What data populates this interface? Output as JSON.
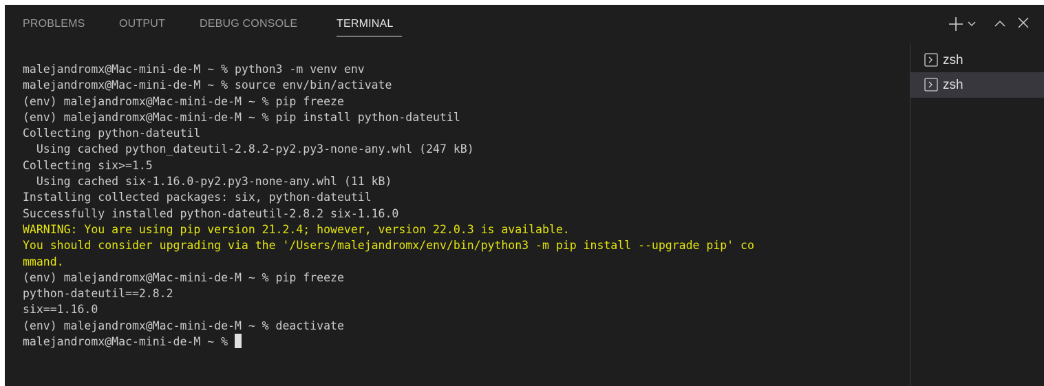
{
  "tabs": [
    {
      "label": "PROBLEMS",
      "active": false
    },
    {
      "label": "OUTPUT",
      "active": false
    },
    {
      "label": "DEBUG CONSOLE",
      "active": false
    },
    {
      "label": "TERMINAL",
      "active": true
    }
  ],
  "toolbar": {
    "icons": [
      "plus-icon",
      "chevron-down-icon",
      "chevron-up-icon",
      "close-icon"
    ]
  },
  "terminal": {
    "lines": [
      {
        "text": "malejandromx@Mac-mini-de-M ~ % python3 -m venv env",
        "kind": "normal"
      },
      {
        "text": "malejandromx@Mac-mini-de-M ~ % source env/bin/activate",
        "kind": "normal"
      },
      {
        "text": "(env) malejandromx@Mac-mini-de-M ~ % pip freeze",
        "kind": "normal"
      },
      {
        "text": "(env) malejandromx@Mac-mini-de-M ~ % pip install python-dateutil",
        "kind": "normal"
      },
      {
        "text": "Collecting python-dateutil",
        "kind": "normal"
      },
      {
        "text": "  Using cached python_dateutil-2.8.2-py2.py3-none-any.whl (247 kB)",
        "kind": "normal"
      },
      {
        "text": "Collecting six>=1.5",
        "kind": "normal"
      },
      {
        "text": "  Using cached six-1.16.0-py2.py3-none-any.whl (11 kB)",
        "kind": "normal"
      },
      {
        "text": "Installing collected packages: six, python-dateutil",
        "kind": "normal"
      },
      {
        "text": "Successfully installed python-dateutil-2.8.2 six-1.16.0",
        "kind": "normal"
      },
      {
        "text": "WARNING: You are using pip version 21.2.4; however, version 22.0.3 is available.",
        "kind": "warn"
      },
      {
        "text": "You should consider upgrading via the '/Users/malejandromx/env/bin/python3 -m pip install --upgrade pip' co",
        "kind": "warn"
      },
      {
        "text": "mmand.",
        "kind": "warn"
      },
      {
        "text": "(env) malejandromx@Mac-mini-de-M ~ % pip freeze",
        "kind": "normal"
      },
      {
        "text": "python-dateutil==2.8.2",
        "kind": "normal"
      },
      {
        "text": "six==1.16.0",
        "kind": "normal"
      },
      {
        "text": "(env) malejandromx@Mac-mini-de-M ~ % deactivate",
        "kind": "normal"
      },
      {
        "text": "malejandromx@Mac-mini-de-M ~ % ",
        "kind": "prompt"
      }
    ]
  },
  "sidebar": {
    "items": [
      {
        "label": "zsh",
        "icon": "terminal-icon",
        "selected": false
      },
      {
        "label": "zsh",
        "icon": "terminal-icon",
        "selected": true
      }
    ]
  },
  "colors": {
    "background": "#1e1e1e",
    "foreground": "#cccccc",
    "warning": "#e5e510",
    "selected_item": "#37373d"
  }
}
